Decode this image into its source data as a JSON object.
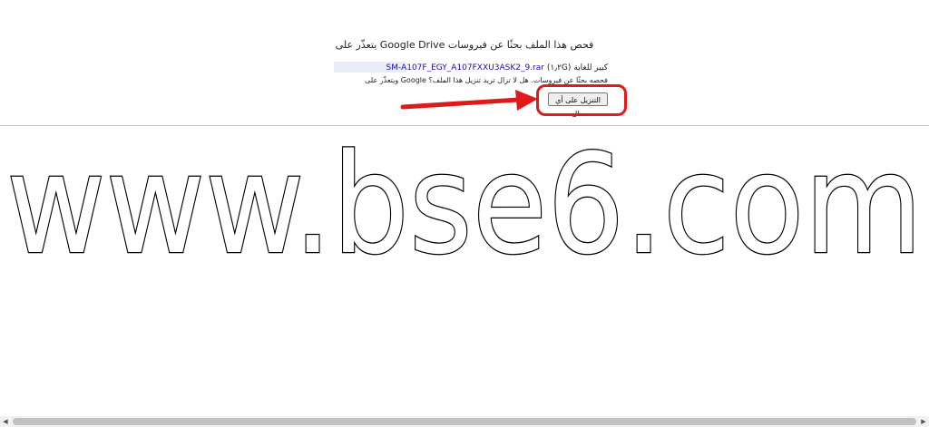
{
  "notice": {
    "title": "فحص هذا الملف بحثًا عن فيروسات Google Drive يتعذّر على",
    "file_label": "كبير للغاية",
    "file_size": "(١٫٢G)",
    "file_name": "SM-A107F_EGY_A107FXXU3ASK2_9.rar",
    "warning": "فحصه بحثًا عن فيروسات. هل لا تزال تريد تنزيل هذا الملف؟ Google ويتعذّر على",
    "download_button_label": "التنزيل على أي حال"
  },
  "watermark": {
    "text": "www.bse6.com"
  },
  "colors": {
    "link": "#1a0dab",
    "highlight": "#e01919",
    "redacted": "#e8edf7"
  },
  "icons": {
    "scroll_left": "scroll-left-arrow-icon",
    "scroll_right": "scroll-right-arrow-icon",
    "annotation": "red-arrow-icon"
  }
}
